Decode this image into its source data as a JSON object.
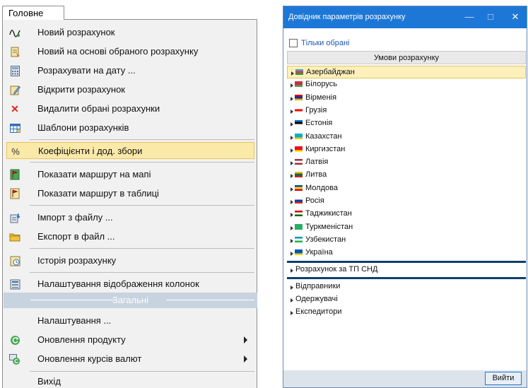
{
  "menu": {
    "tab_label": "Головне",
    "section_header": "Загальні",
    "items": [
      {
        "label": "Новий розрахунок",
        "icon": "new-calc-icon"
      },
      {
        "label": "Новий на основі обраного розрахунку",
        "icon": "copy-calc-icon"
      },
      {
        "label": "Розрахувати на дату ...",
        "icon": "calculator-icon"
      },
      {
        "label": "Відкрити розрахунок",
        "icon": "edit-icon"
      },
      {
        "label": "Видалити обрані розрахунки",
        "icon": "delete-icon"
      },
      {
        "label": "Шаблони розрахунків",
        "icon": "table-icon"
      },
      {
        "label": "Коефіцієнти і дод. збори",
        "icon": "percent-icon"
      },
      {
        "label": "Показати маршрут на мапі",
        "icon": "map-route-icon"
      },
      {
        "label": "Показати маршрут в таблиці",
        "icon": "table-route-icon"
      },
      {
        "label": "Імпорт з файлу ...",
        "icon": "import-icon"
      },
      {
        "label": "Експорт в файл ...",
        "icon": "export-folder-icon"
      },
      {
        "label": "Історія розрахунку",
        "icon": "history-icon"
      },
      {
        "label": "Налаштування відображення колонок",
        "icon": "columns-icon"
      },
      {
        "label": "Налаштування ...",
        "icon": ""
      },
      {
        "label": "Оновлення продукту",
        "icon": "refresh-icon"
      },
      {
        "label": "Оновлення курсів валют",
        "icon": "currency-refresh-icon"
      },
      {
        "label": "Вихід",
        "icon": ""
      }
    ]
  },
  "dialog": {
    "title": "Довідник параметрів розрахунку",
    "minimize": "—",
    "maximize": "□",
    "close": "✕",
    "only_selected_label": "Тільки обрані",
    "column_header": "Умови розрахунку",
    "countries": [
      {
        "label": "Азербайджан",
        "flag": [
          "#3f9fd9",
          "#e23b3b",
          "#2e9c48"
        ]
      },
      {
        "label": "Білорусь",
        "flag": [
          "#c8313e",
          "#c8313e",
          "#4aa657"
        ]
      },
      {
        "label": "Вірменія",
        "flag": [
          "#d90012",
          "#0033a0",
          "#f2a800"
        ]
      },
      {
        "label": "Грузія",
        "flag": [
          "#ffffff",
          "#ff0000",
          "#ffffff"
        ]
      },
      {
        "label": "Естонія",
        "flag": [
          "#0072ce",
          "#000000",
          "#ffffff"
        ]
      },
      {
        "label": "Казахстан",
        "flag": [
          "#00afca",
          "#00afca",
          "#fec50c"
        ]
      },
      {
        "label": "Киргизстан",
        "flag": [
          "#e8112d",
          "#e8112d",
          "#ffef00"
        ]
      },
      {
        "label": "Латвія",
        "flag": [
          "#9e3039",
          "#ffffff",
          "#9e3039"
        ]
      },
      {
        "label": "Литва",
        "flag": [
          "#fdb913",
          "#006a44",
          "#c1272d"
        ]
      },
      {
        "label": "Молдова",
        "flag": [
          "#0046ae",
          "#ffd200",
          "#cc092f"
        ]
      },
      {
        "label": "Росія",
        "flag": [
          "#ffffff",
          "#0039a6",
          "#d52b1e"
        ]
      },
      {
        "label": "Таджикистан",
        "flag": [
          "#cc0000",
          "#ffffff",
          "#006600"
        ]
      },
      {
        "label": "Туркменістан",
        "flag": [
          "#28ae66",
          "#28ae66",
          "#28ae66"
        ]
      },
      {
        "label": "Узбекистан",
        "flag": [
          "#0099b5",
          "#ffffff",
          "#1eb53a"
        ]
      },
      {
        "label": "Україна",
        "flag": [
          "#0057b7",
          "#0057b7",
          "#ffd700"
        ]
      }
    ],
    "group_tp": "Розрахунок за ТП СНД",
    "groups": [
      "Відправники",
      "Одержувачі",
      "Експедитори"
    ],
    "exit_label": "Вийти"
  },
  "colors": {
    "menu_selected": "#fbe9a8",
    "title_bar": "#1d77d7",
    "section_header": "#c8d3e0"
  }
}
